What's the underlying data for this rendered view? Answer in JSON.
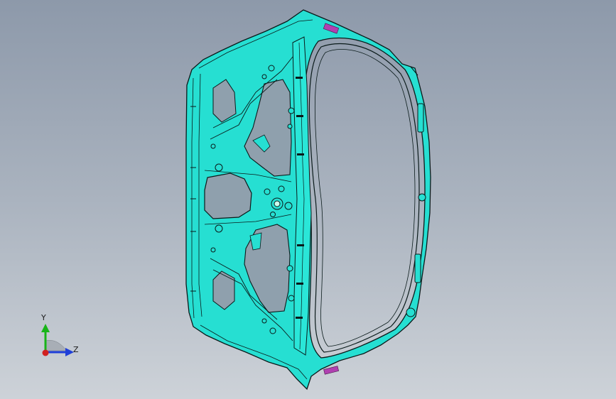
{
  "triad": {
    "y_label": "Y",
    "z_label": "Z",
    "y_color": "#18b418",
    "z_color": "#1f3fd8",
    "x_color": "#d02020"
  },
  "model": {
    "face_color": "#25e0d3",
    "edge_color": "#0a1a1a",
    "highlight_color": "#b040b0"
  }
}
